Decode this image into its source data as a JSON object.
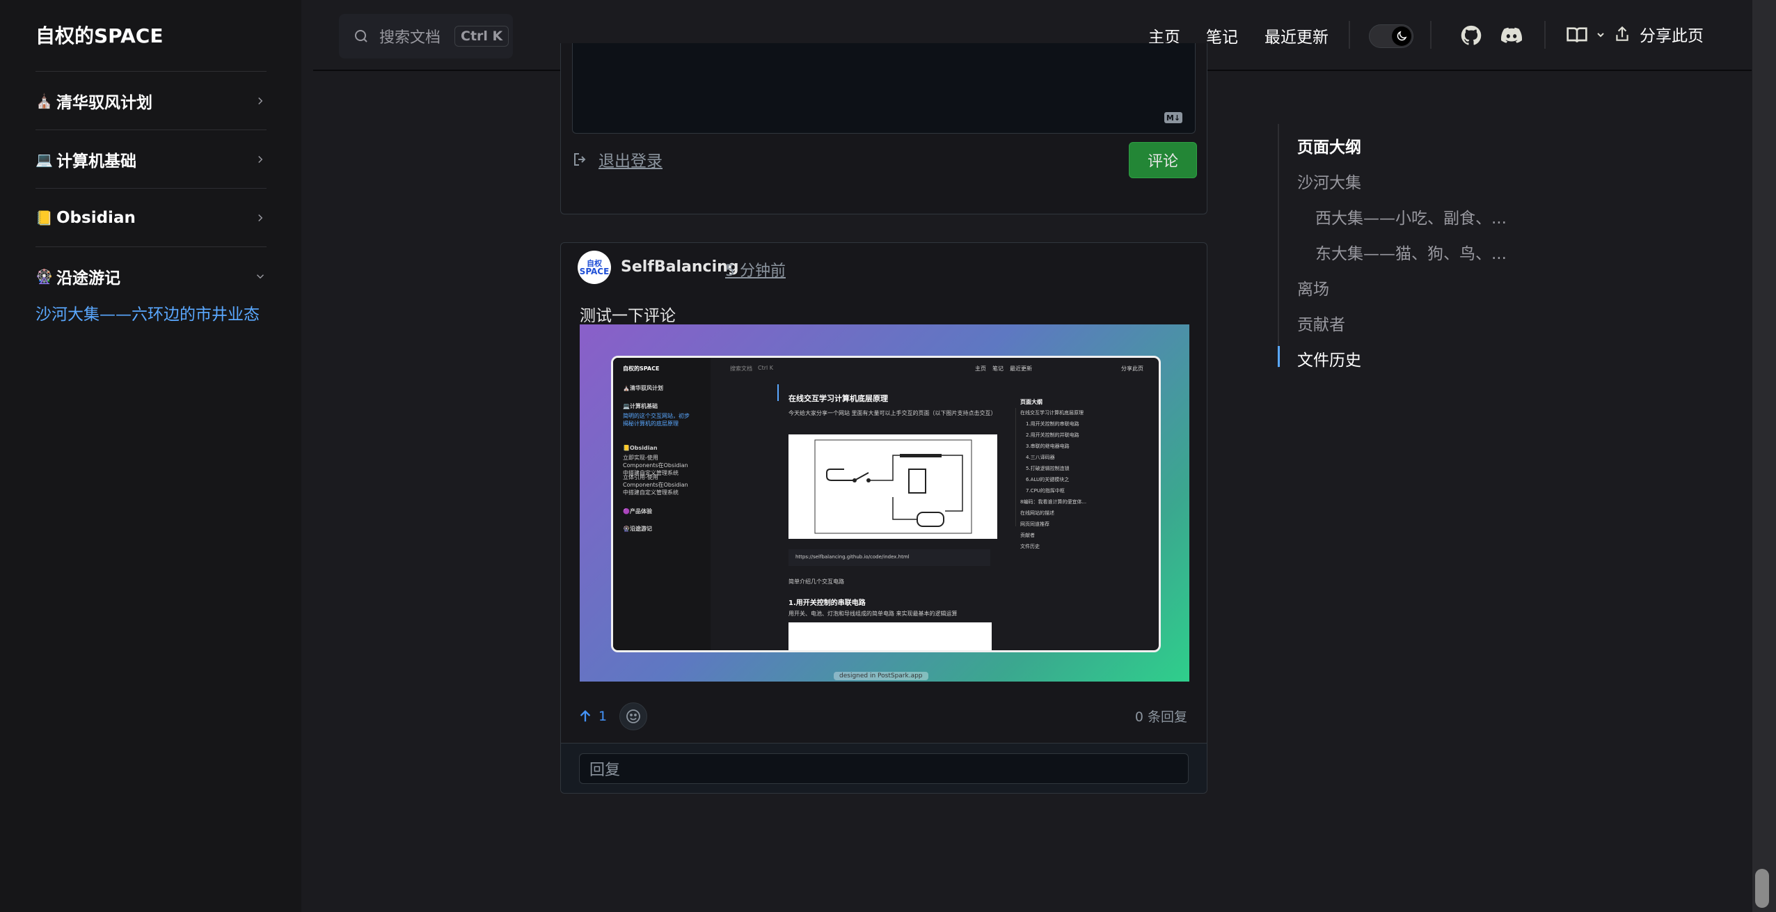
{
  "sidebar": {
    "logo": "自权的SPACE",
    "groups": [
      {
        "emoji": "⛪",
        "label": "清华驭风计划",
        "expanded": false
      },
      {
        "emoji": "💻",
        "label": "计算机基础",
        "expanded": false
      },
      {
        "emoji": "📒",
        "label": "Obsidian",
        "expanded": false
      },
      {
        "emoji": "🎡",
        "label": "沿途游记",
        "expanded": true
      }
    ],
    "active_link": "沙河大集——六环边的市井业态"
  },
  "topbar": {
    "search_placeholder": "搜索文档",
    "search_shortcut": "Ctrl K",
    "nav": [
      "主页",
      "笔记",
      "最近更新"
    ],
    "share_label": "分享此页"
  },
  "comment_editor": {
    "markdown_badge": "M↓",
    "logout_label": "退出登录",
    "submit_label": "评论"
  },
  "comment": {
    "avatar_text_top": "自权",
    "avatar_text_bottom": "SPACE",
    "author": "SelfBalancing",
    "time": "5 分钟前",
    "body": "测试一下评论",
    "upvotes": "1",
    "reply_count": "0 条回复",
    "reply_placeholder": "回复",
    "screenshot": {
      "logo": "自权的SPACE",
      "search": "搜索文档",
      "search_kbd": "Ctrl K",
      "nav": [
        "主页",
        "笔记",
        "最近更新"
      ],
      "share": "分享此页",
      "side_items": [
        "⛪清华驭风计划",
        "💻计算机基础",
        "简明的这个交互网站，初步揭秘计算机的底层原理",
        "📒Obsidian",
        "立即实现-使用Components在Obsidian中搭建自定义管理系统",
        "立体引用-使用Components在Obsidian中搭建自定义管理系统",
        "🟣产品体验",
        "🎡沿途游记"
      ],
      "doc_title": "在线交互学习计算机底层原理",
      "doc_intro": "今天给大家分享一个网站 里面有大量可以上手交互的页面（以下图片支持点击交互）",
      "doc_url": "https://selfbalancing.github.io/code/index.html",
      "doc_p1": "简单介绍几个交互电路",
      "doc_h2": "1.用开关控制的串联电路",
      "doc_p2": "用开关、电池、灯泡和导线组成的简单电路 来实现最基本的逻辑运算",
      "outline_title": "页面大纲",
      "outline": [
        "在线交互学习计算机底层原理",
        "1.用开关控制的串联电路",
        "2.用开关控制的并联电路",
        "3.串联的继电器电路",
        "4.三八译码器",
        "5.打破逻辑控制连锁",
        "6.ALU的关键模块之",
        "7.CPU的指挥中枢",
        "8编码：我看谁计算的便宜体...",
        "在线网站的描述",
        "网页同道推荐",
        "贡献者",
        "文件历史"
      ],
      "watermark": "designed in PostSpark.app"
    }
  },
  "outline": {
    "title": "页面大纲",
    "items": [
      {
        "label": "沙河大集",
        "level": 1,
        "current": false
      },
      {
        "label": "西大集——小吃、副食、...",
        "level": 2,
        "current": false
      },
      {
        "label": "东大集——猫、狗、鸟、...",
        "level": 2,
        "current": false
      },
      {
        "label": "离场",
        "level": 1,
        "current": false
      },
      {
        "label": "贡献者",
        "level": 1,
        "current": false
      },
      {
        "label": "文件历史",
        "level": 1,
        "current": true
      }
    ]
  },
  "colors": {
    "accent": "#5aa8ff",
    "submit_button": "#238636",
    "background": "#1b1b1f",
    "sidebar": "#161618"
  }
}
